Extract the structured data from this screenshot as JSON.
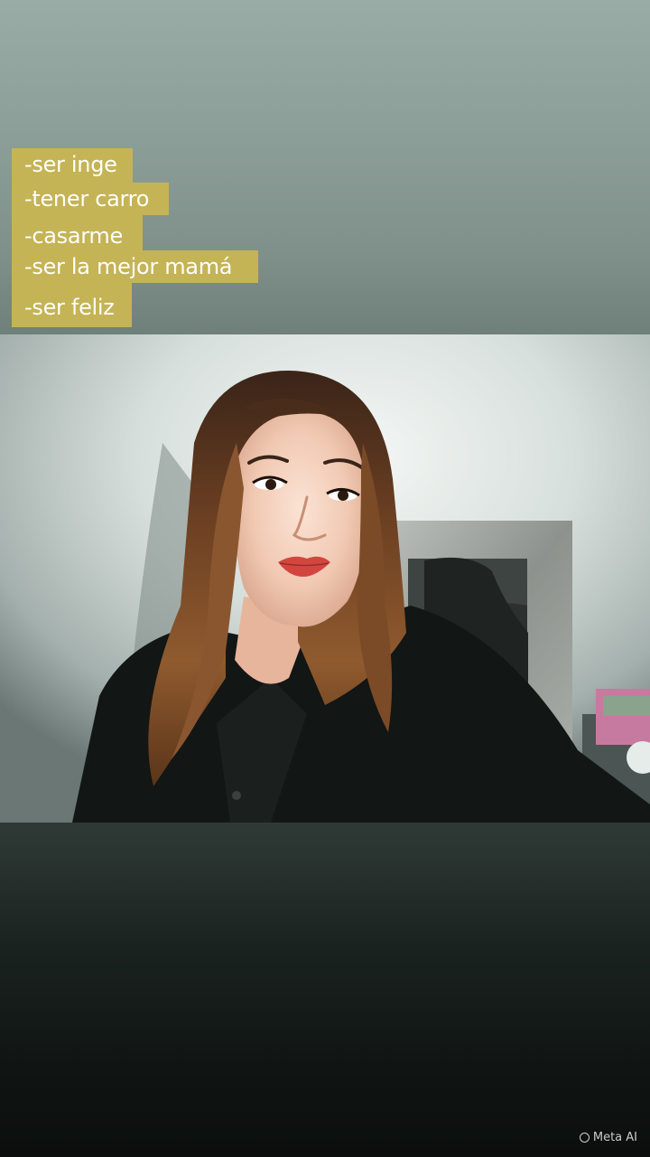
{
  "overlay_text": {
    "lines": [
      "-ser inge",
      "-tener carro",
      "-casarme",
      "-ser la mejor mamá",
      "-ser feliz"
    ],
    "highlight_color": "#c5b455",
    "text_color": "#ffffff"
  },
  "watermark": {
    "label": "Meta AI"
  },
  "colors": {
    "background_top": "#9aaca6",
    "background_bottom": "#0b0e0d"
  }
}
